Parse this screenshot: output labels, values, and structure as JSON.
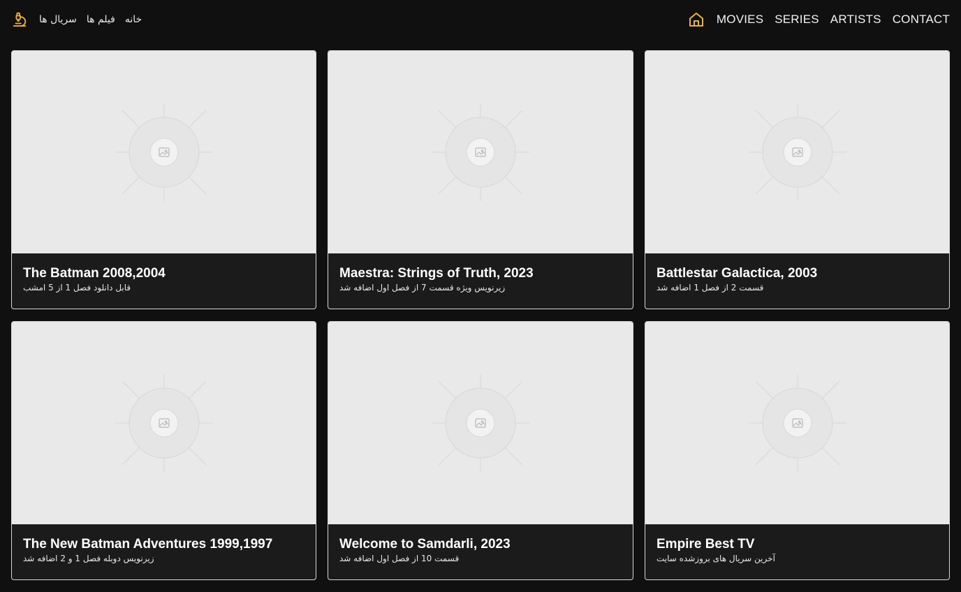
{
  "nav": {
    "left_links": [
      "خانه",
      "فیلم ها",
      "سریال ها"
    ],
    "right_links": [
      "MOVIES",
      "SERIES",
      "ARTISTS",
      "CONTACT"
    ],
    "accent_color": "#f0b429"
  },
  "cards": [
    {
      "title": "The Batman 2008,2004",
      "subtitle": "قابل دانلود فصل 1 از 5 امشب"
    },
    {
      "title": "Maestra: Strings of Truth, 2023",
      "subtitle": "زیرنویس ویژه قسمت 7 از فصل اول اضافه شد"
    },
    {
      "title": "Battlestar Galactica, 2003",
      "subtitle": "قسمت 2 از فصل 1 اضافه شد"
    },
    {
      "title": "The New Batman Adventures 1999,1997",
      "subtitle": "زیرنویس دوبله فصل 1 و 2 اضافه شد"
    },
    {
      "title": "Welcome to Samdarli, 2023",
      "subtitle": "قسمت 10 از فصل اول اضافه شد"
    },
    {
      "title": "Empire Best TV",
      "subtitle": "آخرین سریال های بروزشده سایت"
    }
  ]
}
